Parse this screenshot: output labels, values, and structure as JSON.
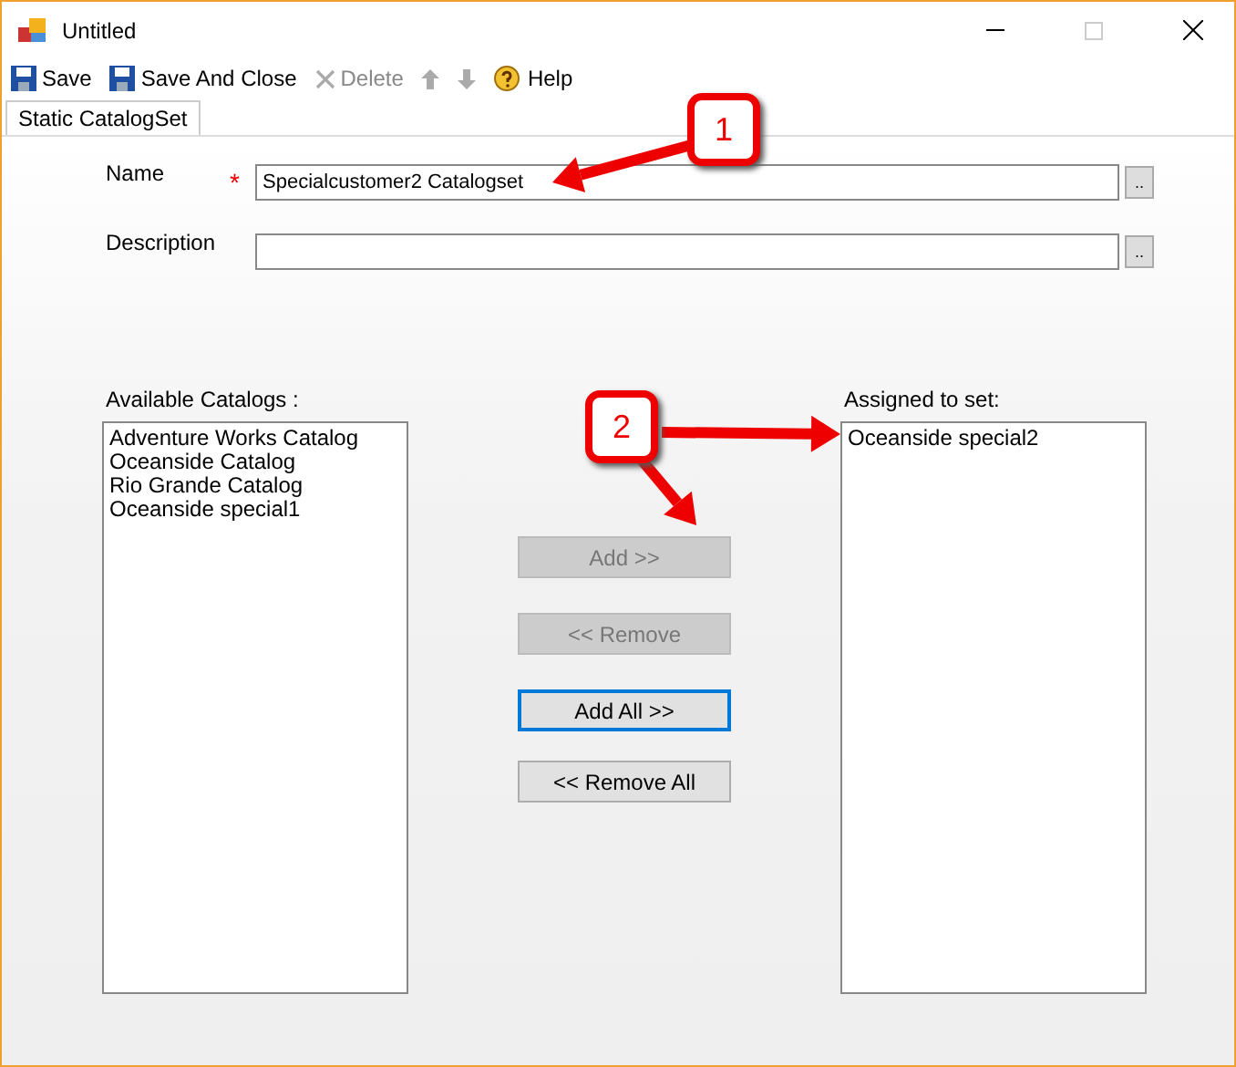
{
  "window": {
    "title": "Untitled",
    "controls": [
      {
        "kind": "minimize",
        "disabled": false
      },
      {
        "kind": "maximize",
        "disabled": true
      },
      {
        "kind": "close",
        "disabled": false
      }
    ]
  },
  "toolbar": [
    {
      "kind": "save",
      "label": "Save",
      "disabled": false
    },
    {
      "kind": "save",
      "label": "Save And Close",
      "disabled": false
    },
    {
      "kind": "delete",
      "label": "Delete",
      "disabled": true
    },
    {
      "kind": "up",
      "disabled": true
    },
    {
      "kind": "down",
      "disabled": true
    },
    {
      "kind": "help",
      "label": "Help",
      "disabled": false
    }
  ],
  "tabs": [
    {
      "label": "Static CatalogSet",
      "selected": true
    }
  ],
  "form": {
    "fields": [
      {
        "label": "Name",
        "required": true,
        "value": "Specialcustomer2 Catalogset",
        "browse": ".."
      },
      {
        "label": "Description",
        "required": false,
        "browse": ".."
      }
    ],
    "required_mark": "*"
  },
  "available": {
    "label": "Available Catalogs :",
    "items": [
      "Adventure Works Catalog",
      "Oceanside Catalog",
      "Rio Grande Catalog",
      "Oceanside special1"
    ]
  },
  "assigned": {
    "label": "Assigned to set:",
    "items": [
      "Oceanside special2"
    ]
  },
  "buttons": [
    {
      "label": "Add >>",
      "disabled": true,
      "focused": false
    },
    {
      "label": "<< Remove",
      "disabled": true,
      "focused": false
    },
    {
      "label": "Add All >>",
      "disabled": false,
      "focused": true
    },
    {
      "label": "<< Remove All",
      "disabled": false,
      "focused": false
    }
  ],
  "callouts": [
    {
      "number": "1"
    },
    {
      "number": "2"
    }
  ]
}
